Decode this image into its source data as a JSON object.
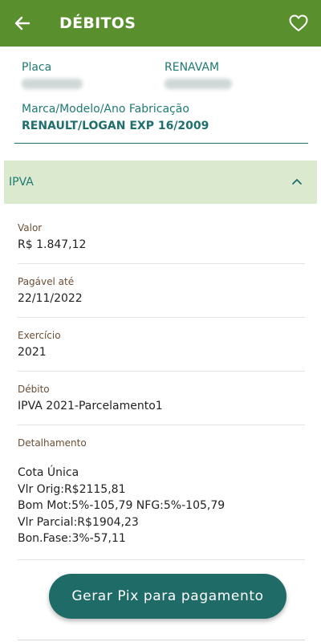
{
  "header": {
    "title": "DÉBITOS",
    "back_icon": "arrow-left-icon",
    "favorite_icon": "heart-outline-icon"
  },
  "vehicle": {
    "placa_label": "Placa",
    "renavam_label": "RENAVAM",
    "marca_label": "Marca/Modelo/Ano Fabricação",
    "marca_value": "RENAULT/LOGAN EXP 16/2009"
  },
  "section": {
    "title": "IPVA",
    "toggle_icon": "chevron-up-icon"
  },
  "fields": {
    "valor": {
      "label": "Valor",
      "value": "R$ 1.847,12"
    },
    "pagavel": {
      "label": "Pagável até",
      "value": "22/11/2022"
    },
    "exercicio": {
      "label": "Exercício",
      "value": "2021"
    },
    "debito": {
      "label": "Débito",
      "value": "IPVA 2021-Parcelamento1"
    },
    "detalhamento": {
      "label": "Detalhamento",
      "lines": [
        "Cota Única",
        "Vlr Orig:R$2115,81",
        "Bom Mot:5%-105,79 NFG:5%-105,79",
        "Vlr Parcial:R$1904,23",
        "Bon.Fase:3%-57,11"
      ]
    }
  },
  "actions": {
    "pix_label": "Gerar Pix para pagamento"
  },
  "colors": {
    "topbar": "#5a8f2d",
    "accent": "#1f6f6f",
    "section_bg": "#dbe9cf",
    "label_brown": "#6b4e35"
  }
}
